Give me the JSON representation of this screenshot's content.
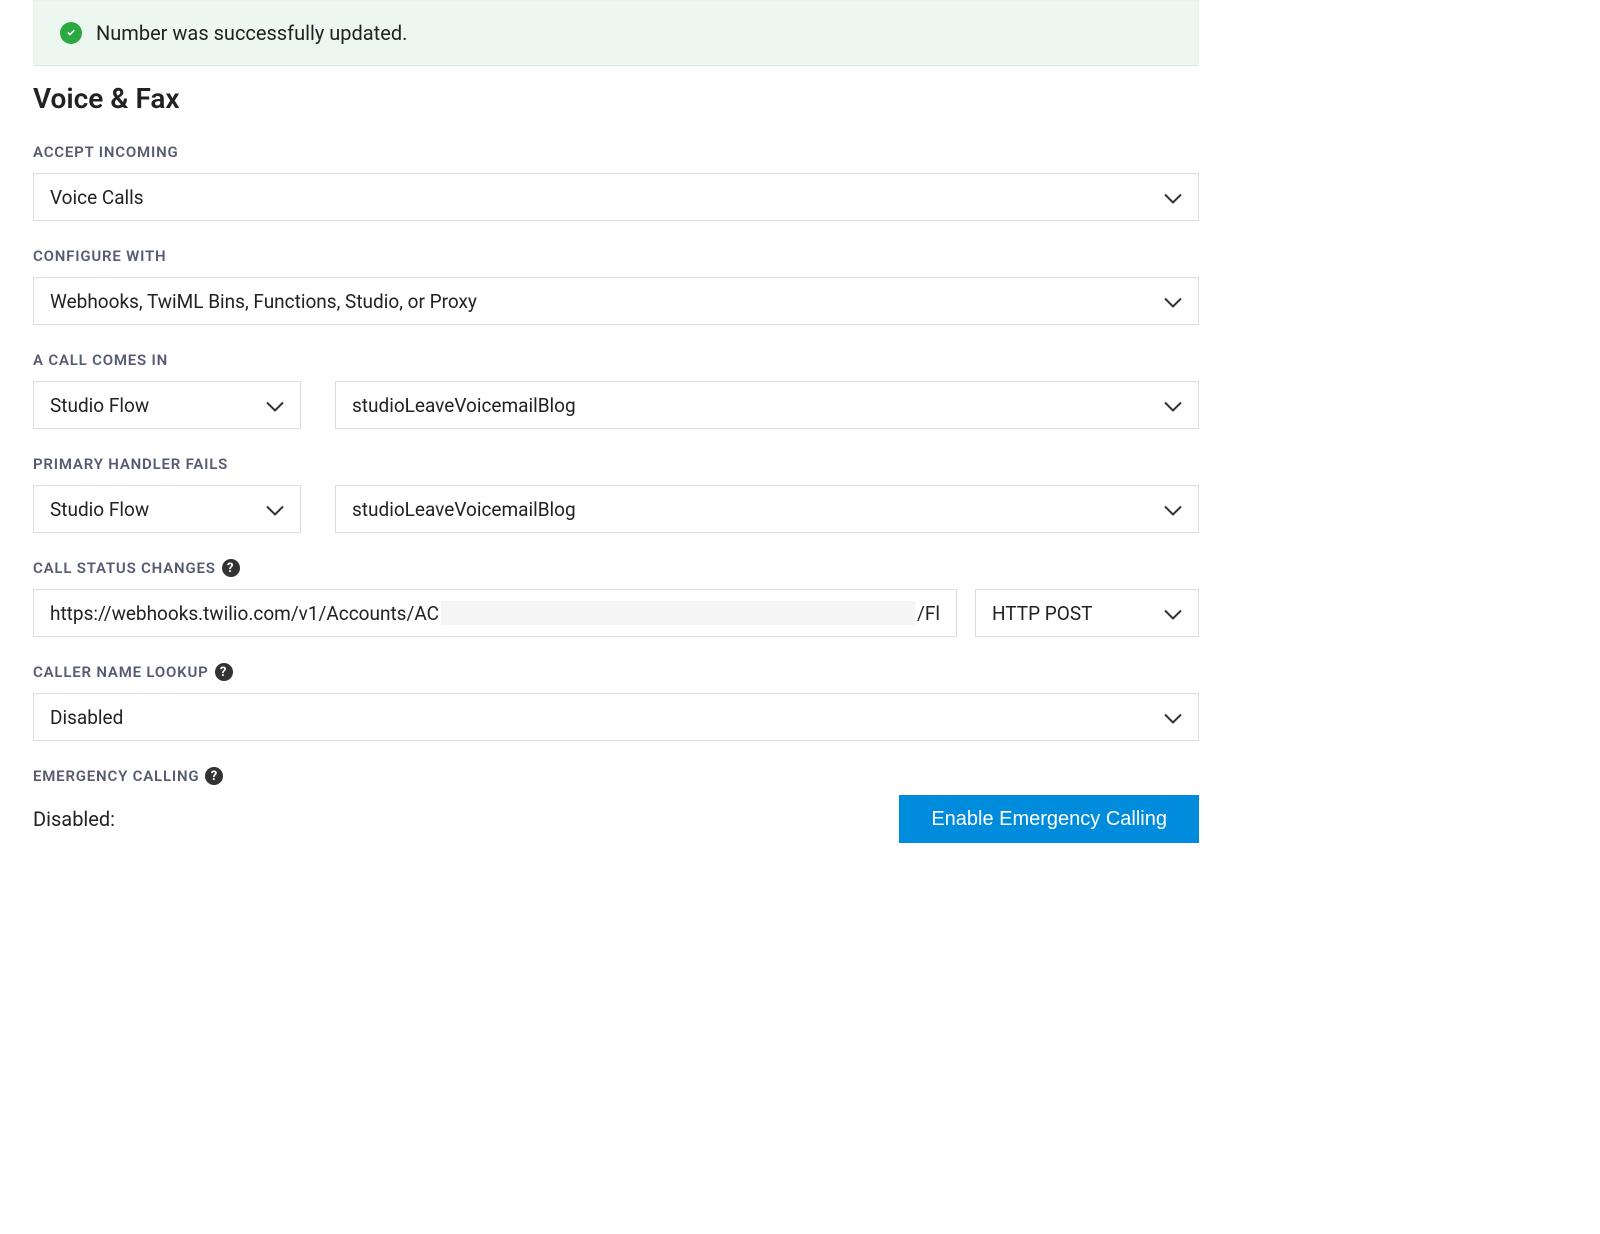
{
  "alert": {
    "message": "Number was successfully updated."
  },
  "heading": "Voice & Fax",
  "accept_incoming": {
    "label": "Accept Incoming",
    "value": "Voice Calls"
  },
  "configure_with": {
    "label": "Configure With",
    "value": "Webhooks, TwiML Bins, Functions, Studio, or Proxy"
  },
  "call_comes_in": {
    "label": "A Call Comes In",
    "handler_type": "Studio Flow",
    "handler_value": "studioLeaveVoicemailBlog"
  },
  "primary_handler_fails": {
    "label": "Primary Handler Fails",
    "handler_type": "Studio Flow",
    "handler_value": "studioLeaveVoicemailBlog"
  },
  "call_status_changes": {
    "label": "Call Status Changes",
    "url_prefix": "https://webhooks.twilio.com/v1/Accounts/AC",
    "url_suffix": "/Fl",
    "method": "HTTP POST"
  },
  "caller_name_lookup": {
    "label": "Caller Name Lookup",
    "value": "Disabled"
  },
  "emergency_calling": {
    "label": "Emergency Calling",
    "status": "Disabled:",
    "button": "Enable Emergency Calling"
  }
}
